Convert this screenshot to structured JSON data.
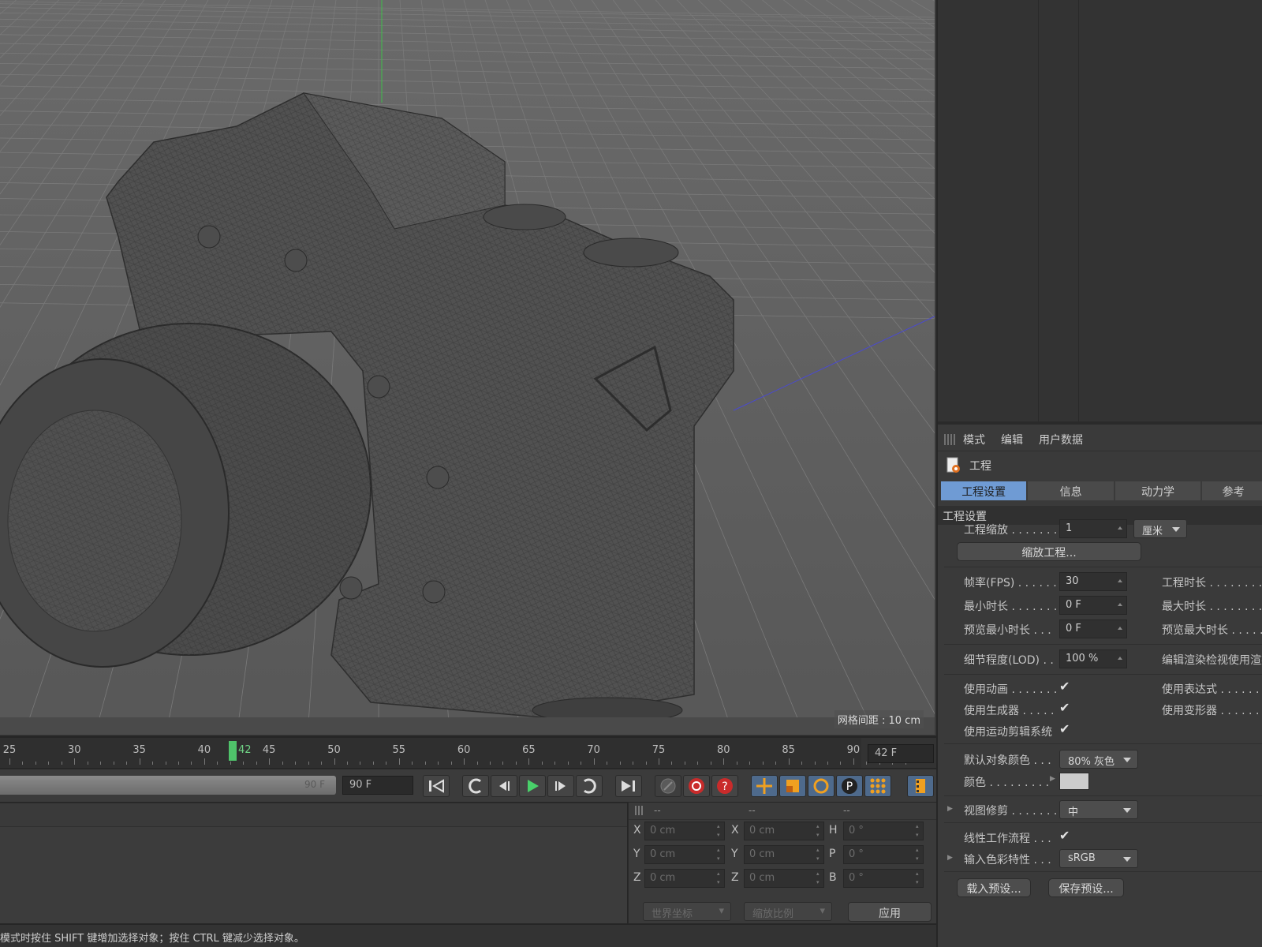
{
  "viewport": {
    "grid_spacing_label": "网格间距 : 10 cm"
  },
  "timeline": {
    "ticks": [
      "25",
      "30",
      "35",
      "40",
      "45",
      "50",
      "55",
      "60",
      "65",
      "70",
      "75",
      "80",
      "85",
      "90"
    ],
    "current_frame_label": "42",
    "current_frame_field": "42 F"
  },
  "transport": {
    "range_end_label": "90 F",
    "end_field": "90 F"
  },
  "coordinates": {
    "header": [
      "--",
      "--",
      "--"
    ],
    "rows": [
      {
        "pos_label": "X",
        "pos": "0 cm",
        "size_label": "X",
        "size": "0 cm",
        "rot_label": "H",
        "rot": "0 °"
      },
      {
        "pos_label": "Y",
        "pos": "0 cm",
        "size_label": "Y",
        "size": "0 cm",
        "rot_label": "P",
        "rot": "0 °"
      },
      {
        "pos_label": "Z",
        "pos": "0 cm",
        "size_label": "Z",
        "size": "0 cm",
        "rot_label": "B",
        "rot": "0 °"
      }
    ],
    "world_dropdown": "世界坐标",
    "scale_dropdown": "缩放比例",
    "apply_label": "应用"
  },
  "status": {
    "text": "模式时按住 SHIFT 键增加选择对象；按住 CTRL 键减少选择对象。"
  },
  "attributes": {
    "menu": [
      "模式",
      "编辑",
      "用户数据"
    ],
    "object_title": "工程",
    "tabs": [
      "工程设置",
      "信息",
      "动力学",
      "参考"
    ],
    "section": "工程设置",
    "project_scale_label": "工程缩放 . . . . . . .",
    "project_scale_value": "1",
    "project_scale_unit": "厘米",
    "scale_project_button": "缩放工程...",
    "fps_label": "帧率(FPS) . . . . . .",
    "fps_value": "30",
    "project_length_label": "工程时长 . . . . . . . .",
    "min_time_label": "最小时长 . . . . . . .",
    "min_time_value": "0 F",
    "max_time_label": "最大时长 . . . . . . . .",
    "preview_min_label": "预览最小时长 . . .",
    "preview_min_value": "0 F",
    "preview_max_label": "预览最大时长 . . . . .",
    "lod_label": "细节程度(LOD) . .",
    "lod_value": "100 %",
    "render_lod_label": "编辑渲染检视使用渲染",
    "use_animation_label": "使用动画 . . . . . . .",
    "use_expressions_label": "使用表达式 . . . . . .",
    "use_generators_label": "使用生成器 . . . . .",
    "use_deformers_label": "使用变形器 . . . . . .",
    "use_motion_label": "使用运动剪辑系统",
    "default_color_label": "默认对象颜色 . . .",
    "default_color_value": "80% 灰色",
    "color_label": "颜色 . . . . . . . . .",
    "view_clip_label": "视图修剪 . . . . . . .",
    "view_clip_value": "中",
    "linear_workflow_label": "线性工作流程 . . .",
    "input_color_label": "输入色彩特性 . . .",
    "input_color_value": "sRGB",
    "load_preset": "载入预设...",
    "save_preset": "保存预设...",
    "checkmark": "✔"
  }
}
